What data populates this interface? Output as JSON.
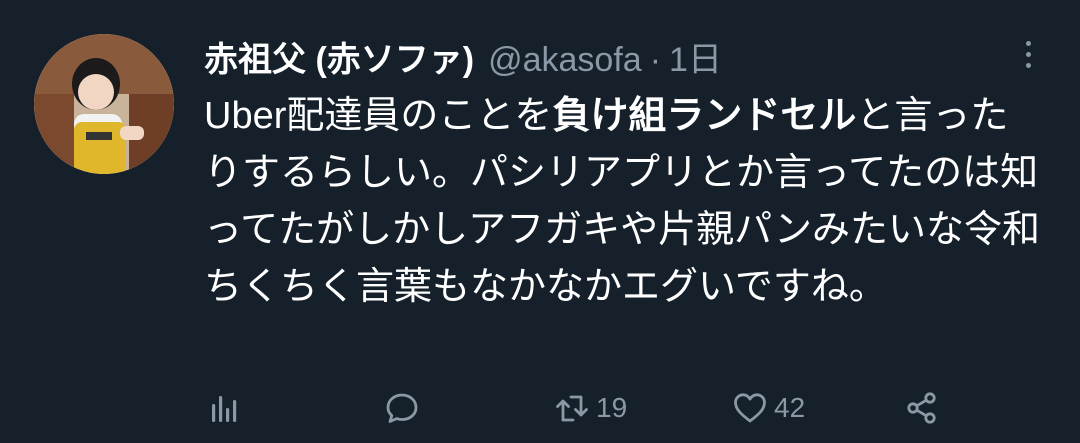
{
  "tweet": {
    "author": {
      "display_name": "赤祖父 (赤ソファ)",
      "handle": "@akasofa",
      "separator": "·",
      "time": "1日"
    },
    "text_before": "Uber配達員のことを",
    "text_bold": "負け組ランドセル",
    "text_after": "と言ったりするらしい。パシリアプリとか言ってたのは知ってたがしかしアフガキや片親パンみたいな令和ちくちく言葉もなかなかエグいですね。",
    "actions": {
      "views_icon": "bar-chart-icon",
      "reply_icon": "speech-bubble-icon",
      "retweet_icon": "retweet-icon",
      "retweet_count": "19",
      "like_icon": "heart-icon",
      "like_count": "42",
      "share_icon": "share-icon"
    }
  },
  "colors": {
    "background": "#15202b",
    "primary_text": "#ffffff",
    "secondary_text": "#8b98a5"
  }
}
